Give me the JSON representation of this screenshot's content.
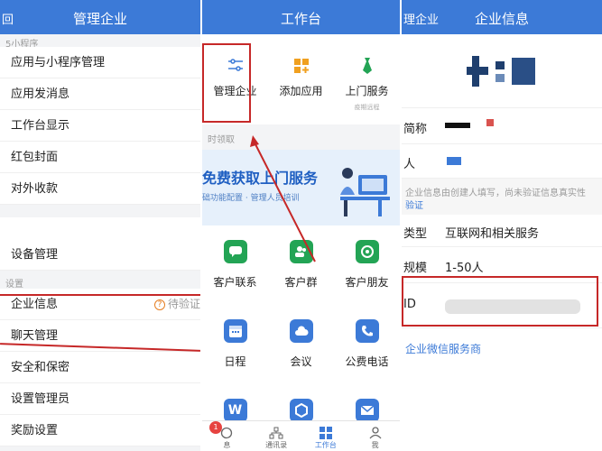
{
  "left_panel": {
    "header": {
      "back": "回",
      "title": "管理企业"
    },
    "section_label_top": "5小程序",
    "group1": [
      "应用与小程序管理",
      "应用发消息",
      "工作台显示",
      "红包封面",
      "对外收款"
    ],
    "device": "设备管理",
    "section_label_settings": "设置",
    "group2": {
      "company_info": "企业信息",
      "company_info_status": "待验证",
      "chat_mgmt": "聊天管理",
      "security": "安全和保密",
      "set_admin": "设置管理员",
      "reward": "奖励设置"
    }
  },
  "middle_panel": {
    "header": {
      "title": "工作台"
    },
    "top_actions": [
      {
        "label": "管理企业",
        "sub": ""
      },
      {
        "label": "添加应用",
        "sub": ""
      },
      {
        "label": "上门服务",
        "sub": "疫期远程"
      }
    ],
    "claim_label": "时领取",
    "banner": {
      "title": "免费获取上门服务",
      "subtitle": "础功能配置 · 管理人员培训"
    },
    "apps": [
      "客户联系",
      "客户群",
      "客户朋友",
      "日程",
      "会议",
      "公费电话",
      "W",
      "",
      ""
    ],
    "tabbar": {
      "items": [
        "息",
        "通讯录",
        "工作台",
        "我"
      ],
      "badge": "1"
    }
  },
  "right_panel": {
    "header": {
      "left": "理企业",
      "title": "企业信息"
    },
    "rows": {
      "short_name_label": "简称",
      "creator_label": "人",
      "note": "企业信息由创建人填写，尚未验证信息真实性",
      "note_link": "验证",
      "type_label": "类型",
      "type_value": "互联网和相关服务",
      "scale_label": "规模",
      "scale_value": "1-50人",
      "id_label": "ID",
      "service_link": "企业微信服务商"
    }
  },
  "colors": {
    "brand_blue": "#3c7ad7",
    "annotation_red": "#c62828"
  }
}
